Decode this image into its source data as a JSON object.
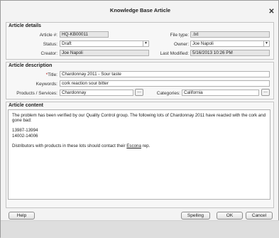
{
  "window": {
    "title": "Knowledge Base Article"
  },
  "details": {
    "section_title": "Article details",
    "article_no_label": "Article #:",
    "article_no": "HQ-KB00011",
    "file_type_label": "File type:",
    "file_type": ".txt",
    "status_label": "Status:",
    "status": "Draft",
    "owner_label": "Owner:",
    "owner": "Joe Napoli",
    "creator_label": "Creator:",
    "creator": "Joe Napoli",
    "last_modified_label": "Last Modified:",
    "last_modified": "5/16/2013 10:26 PM"
  },
  "description": {
    "section_title": "Article description",
    "title_label": "Title:",
    "title_required_mark": "*",
    "title": "Chardonnay 2011 - Sour taste",
    "keywords_label": "Keywords:",
    "keywords": "cork reaction sour bitter",
    "products_label": "Products / Services:",
    "products": "Chardonnay",
    "categories_label": "Categories:",
    "categories": "California",
    "ellipsis": "..."
  },
  "content": {
    "section_title": "Article content",
    "paragraph1": "The problem has been verified by our Quality Control group. The following lots of Chardonnay 2011 have reacted with the cork and gone bad:",
    "lot1": "13987-13994",
    "lot2": "14002-14006",
    "paragraph3_before": "Distributors with products in these lots should contact their ",
    "paragraph3_link": "Escona",
    "paragraph3_after": " rep."
  },
  "buttons": {
    "help": "Help",
    "spelling": "Spelling",
    "ok": "OK",
    "cancel": "Cancel"
  },
  "icons": {
    "close": "close-icon",
    "dropdown": "chevron-down-icon"
  }
}
